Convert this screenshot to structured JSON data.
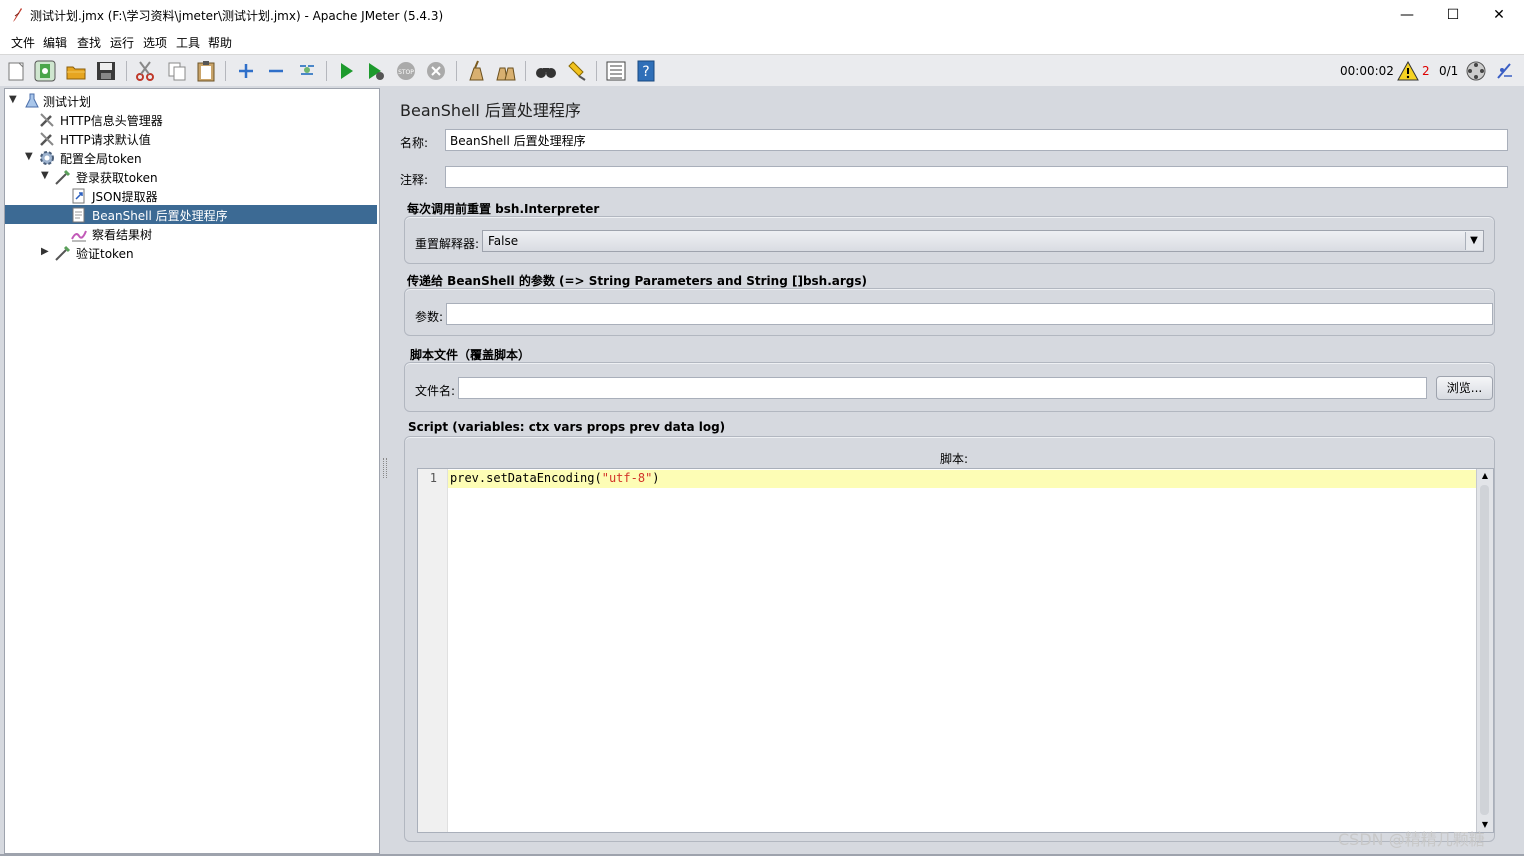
{
  "window": {
    "title": "测试计划.jmx (F:\\学习资料\\jmeter\\测试计划.jmx) - Apache JMeter (5.4.3)",
    "minimize": "—",
    "maximize": "☐",
    "close": "✕"
  },
  "menu": [
    "文件",
    "编辑",
    "查找",
    "运行",
    "选项",
    "工具",
    "帮助"
  ],
  "toolbar_icons": [
    "new-icon",
    "templates-icon",
    "open-icon",
    "save-icon",
    "cut-icon",
    "copy-icon",
    "paste-icon",
    "expand-icon",
    "collapse-icon",
    "toggle-icon",
    "start-icon",
    "start-no-pause-icon",
    "stop-icon",
    "shutdown-icon",
    "clear-icon",
    "clear-all-icon",
    "search-icon",
    "reset-search-icon",
    "function-helper-icon",
    "help-icon"
  ],
  "status": {
    "elapsed": "00:00:02",
    "warnings": "2",
    "threads": "0/1"
  },
  "tree": [
    {
      "label": "测试计划",
      "icon": "test-plan-icon",
      "depth": 0,
      "expanded": true
    },
    {
      "label": "HTTP信息头管理器",
      "icon": "wrench-icon",
      "depth": 1
    },
    {
      "label": "HTTP请求默认值",
      "icon": "wrench-icon",
      "depth": 1
    },
    {
      "label": "配置全局token",
      "icon": "gear-icon",
      "depth": 1,
      "expanded": true
    },
    {
      "label": "登录获取token",
      "icon": "pipette-icon",
      "depth": 2,
      "expanded": true
    },
    {
      "label": "JSON提取器",
      "icon": "extractor-icon",
      "depth": 3
    },
    {
      "label": "BeanShell 后置处理程序",
      "icon": "script-icon",
      "depth": 3,
      "selected": true
    },
    {
      "label": "察看结果树",
      "icon": "listener-icon",
      "depth": 3
    },
    {
      "label": "验证token",
      "icon": "pipette-icon",
      "depth": 2,
      "expanded": false
    }
  ],
  "panel": {
    "title": "BeanShell 后置处理程序",
    "name_label": "名称:",
    "name_value": "BeanShell 后置处理程序",
    "comment_label": "注释:",
    "comment_value": "",
    "reset_section": "每次调用前重置 bsh.Interpreter",
    "reset_label": "重置解释器:",
    "reset_value": "False",
    "params_section": "传递给 BeanShell 的参数 (=> String Parameters and String []bsh.args)",
    "params_label": "参数:",
    "params_value": "",
    "file_section": "脚本文件（覆盖脚本）",
    "file_label": "文件名:",
    "file_value": "",
    "browse_button": "浏览...",
    "script_section": "Script (variables: ctx vars props prev data log)",
    "script_label": "脚本:",
    "line_number": "1",
    "code_prefix": "prev.setDataEncoding(",
    "code_string": "\"utf-8\"",
    "code_suffix": ")"
  },
  "watermark": "CSDN @精精几颗糖",
  "colors": {
    "selection": "#3c6a94",
    "panel_bg": "#d6d9df",
    "current_line": "#fdfdb5",
    "code_string": "#d2342a",
    "warning": "#dd0000"
  }
}
